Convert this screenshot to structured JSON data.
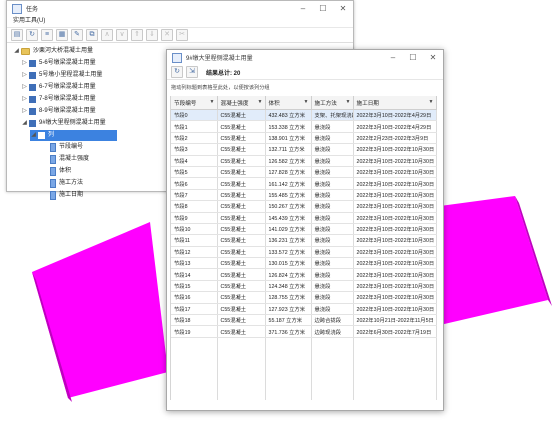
{
  "back_window": {
    "title": "任务",
    "menu": "实用工具(U)",
    "tree": {
      "root": "沙栗河大桥混凝土用量",
      "items": [
        "5-6号墩梁混凝土用量",
        "5号墩小里程混凝土用量",
        "6-7号墩梁混凝土用量",
        "7-8号墩梁混凝土用量",
        "8-9号墩梁混凝土用量",
        "9#墩大里程侧混凝土用量"
      ],
      "child": "列",
      "columns": [
        "节段编号",
        "混凝土强度",
        "体积",
        "施工方法",
        "施工日期"
      ]
    }
  },
  "front_window": {
    "title": "9#墩大里程侧混凝土用量",
    "summary": "结果总计: 20",
    "hint": "拖动列标题到表格至此处，以便按该列分组",
    "columns": [
      "节段编号",
      "混凝土强度",
      "体积",
      "施工方法",
      "施工日期"
    ],
    "rows": [
      [
        "节段0",
        "C55混凝土",
        "432.483 立方米",
        "支架、托架现浇段",
        "2022年3月10日-2022年4月29日"
      ],
      [
        "节段1",
        "C55混凝土",
        "153.338 立方米",
        "悬浇段",
        "2022年3月10日-2022年4月29日"
      ],
      [
        "节段2",
        "C55混凝土",
        "138.901 立方米",
        "悬浇段",
        "2022年2月23日-2022年3月9日"
      ],
      [
        "节段3",
        "C55混凝土",
        "132.711 立方米",
        "悬浇段",
        "2022年3月10日-2022年10月30日"
      ],
      [
        "节段4",
        "C55混凝土",
        "126.582 立方米",
        "悬浇段",
        "2022年3月10日-2022年10月30日"
      ],
      [
        "节段5",
        "C55混凝土",
        "127.828 立方米",
        "悬浇段",
        "2022年3月10日-2022年10月30日"
      ],
      [
        "节段6",
        "C55混凝土",
        "161.142 立方米",
        "悬浇段",
        "2022年3月10日-2022年10月30日"
      ],
      [
        "节段7",
        "C55混凝土",
        "155.485 立方米",
        "悬浇段",
        "2022年3月10日-2022年10月30日"
      ],
      [
        "节段8",
        "C55混凝土",
        "150.267 立方米",
        "悬浇段",
        "2022年3月10日-2022年10月30日"
      ],
      [
        "节段9",
        "C55混凝土",
        "145.439 立方米",
        "悬浇段",
        "2022年3月10日-2022年10月30日"
      ],
      [
        "节段10",
        "C55混凝土",
        "141.029 立方米",
        "悬浇段",
        "2022年3月10日-2022年10月30日"
      ],
      [
        "节段11",
        "C55混凝土",
        "136.231 立方米",
        "悬浇段",
        "2022年3月10日-2022年10月30日"
      ],
      [
        "节段12",
        "C55混凝土",
        "133.572 立方米",
        "悬浇段",
        "2022年3月10日-2022年10月30日"
      ],
      [
        "节段13",
        "C55混凝土",
        "130.015 立方米",
        "悬浇段",
        "2022年3月10日-2022年10月30日"
      ],
      [
        "节段14",
        "C55混凝土",
        "126.824 立方米",
        "悬浇段",
        "2022年3月10日-2022年10月30日"
      ],
      [
        "节段15",
        "C55混凝土",
        "124.348 立方米",
        "悬浇段",
        "2022年3月10日-2022年10月30日"
      ],
      [
        "节段16",
        "C55混凝土",
        "128.755 立方米",
        "悬浇段",
        "2022年3月10日-2022年10月30日"
      ],
      [
        "节段17",
        "C55混凝土",
        "127.923 立方米",
        "悬浇段",
        "2022年3月10日-2022年10月30日"
      ],
      [
        "节段18",
        "C55混凝土",
        "55.187 立方米",
        "边跨合拢段",
        "2022年10月21日-2022年11月5日"
      ],
      [
        "节段19",
        "C55混凝土",
        "371.736 立方米",
        "边跨现浇段",
        "2022年6月30日-2022年7月19日"
      ]
    ]
  },
  "colors": {
    "slab": "#ff00ff",
    "slab_shade": "#b800b8",
    "selection": "#3c82e0"
  }
}
